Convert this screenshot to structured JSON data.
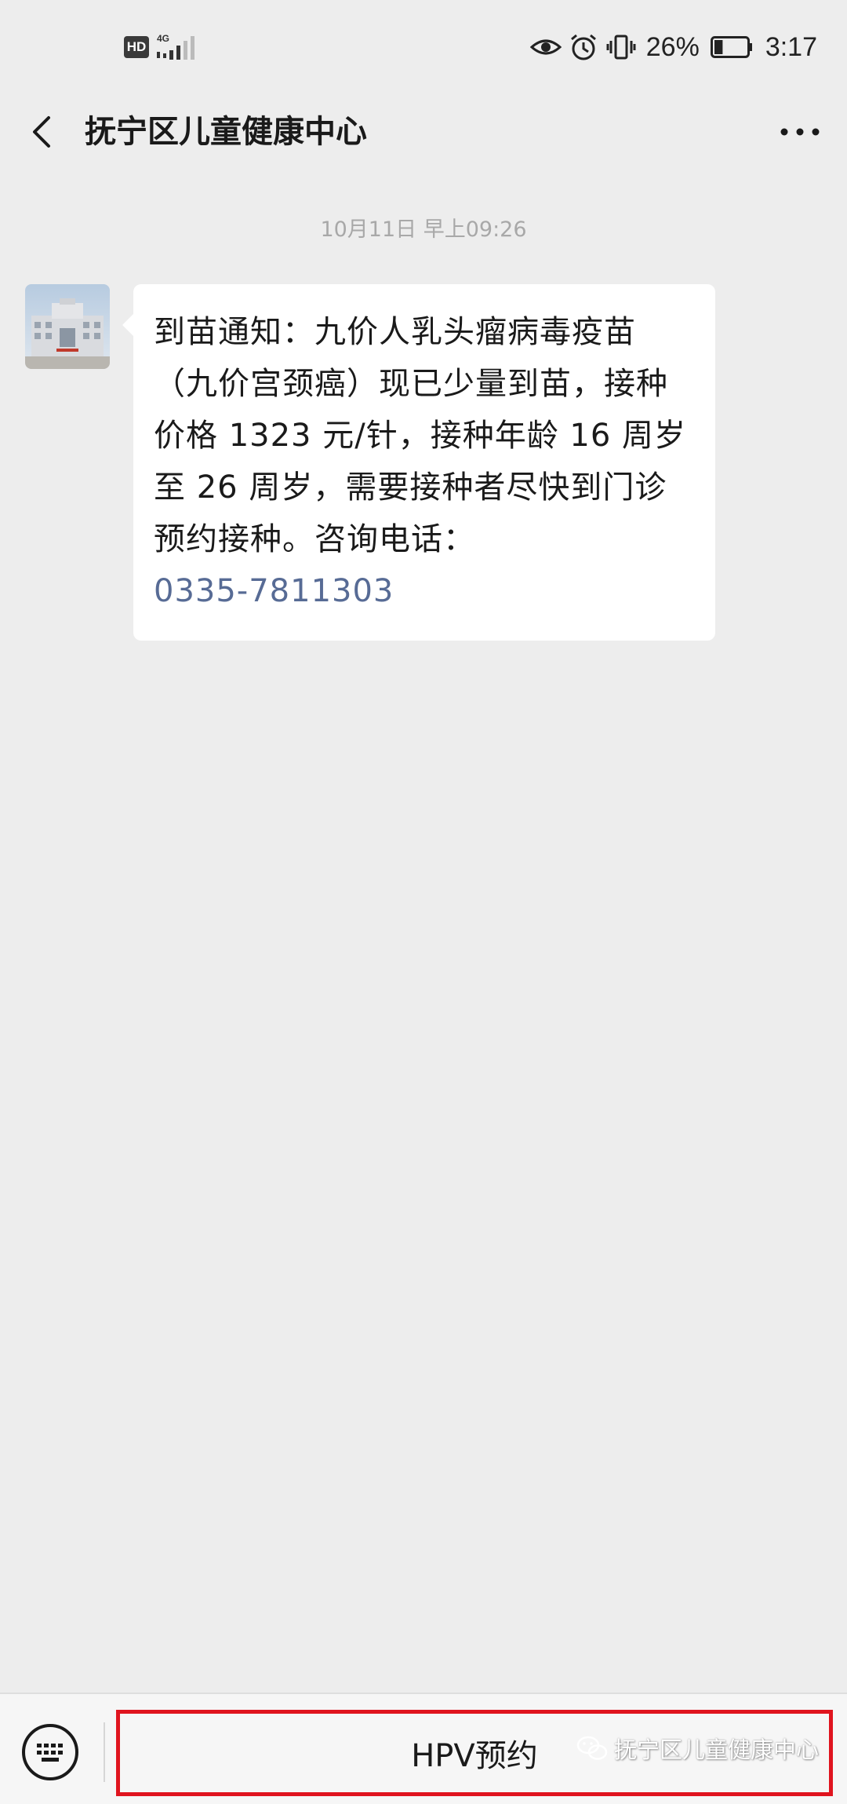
{
  "status_bar": {
    "hd_badge": "HD",
    "network": "4G",
    "battery_percent": "26%",
    "battery_level": 0.26,
    "time": "3:17",
    "icons": [
      "eye-icon",
      "alarm-icon",
      "vibrate-icon",
      "battery-icon"
    ]
  },
  "header": {
    "title": "抚宁区儿童健康中心",
    "back_icon": "back-chevron-icon",
    "more_icon": "more-dots-icon"
  },
  "conversation": {
    "timestamp": "10月11日 早上09:26",
    "message": {
      "sender_avatar": "hospital-building-avatar",
      "text": "到苗通知：九价人乳头瘤病毒疫苗（九价宫颈癌）现已少量到苗，接种价格 1323 元/针，接种年龄 16 周岁至 26 周岁，需要接种者尽快到门诊预约接种。咨询电话：",
      "phone": "0335-7811303"
    }
  },
  "bottom_bar": {
    "keyboard_icon": "keyboard-icon",
    "menu_button_label": "HPV预约",
    "watermark_text": "抚宁区儿童健康中心",
    "watermark_icon": "wechat-icon"
  },
  "colors": {
    "background": "#ededed",
    "bubble": "#ffffff",
    "link": "#576b95",
    "highlight_border": "#e0141e",
    "timestamp": "#a8a8a8"
  }
}
